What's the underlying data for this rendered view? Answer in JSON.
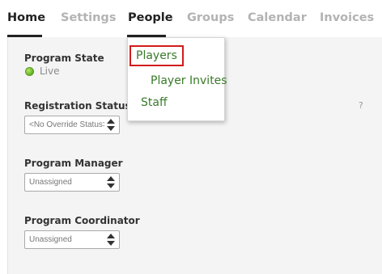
{
  "tabs": [
    {
      "label": "Home"
    },
    {
      "label": "Settings"
    },
    {
      "label": "People"
    },
    {
      "label": "Groups"
    },
    {
      "label": "Calendar"
    },
    {
      "label": "Invoices"
    }
  ],
  "fields": {
    "program_state": {
      "label": "Program State",
      "status": "Live"
    },
    "registration_status": {
      "label": "Registration Status",
      "selected": "<No Override Status>",
      "help": "?"
    },
    "program_manager": {
      "label": "Program Manager",
      "selected": "Unassigned"
    },
    "program_coordinator": {
      "label": "Program Coordinator",
      "selected": "Unassigned"
    }
  },
  "people_menu": {
    "items": [
      {
        "label": "Players"
      },
      {
        "label": "Player Invites"
      },
      {
        "label": "Staff"
      }
    ]
  },
  "colors": {
    "active_tab": "#222222",
    "inactive_tab": "#b3b3b3",
    "menu_link": "#3a7a2a",
    "highlight_box": "#d21b1b",
    "live_indicator": "#6fbe2e"
  }
}
